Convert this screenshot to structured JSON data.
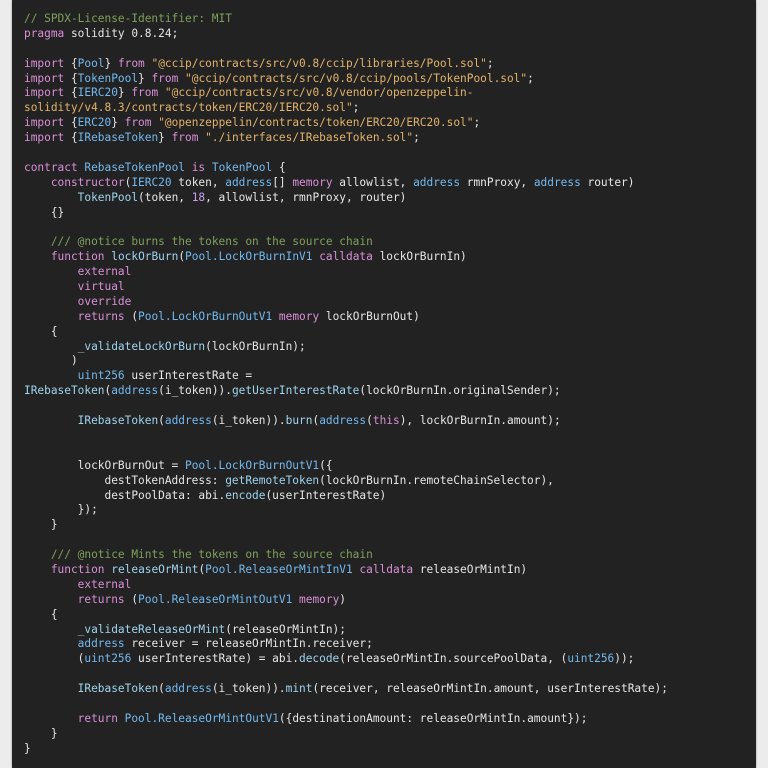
{
  "editor": {
    "theme_colors": {
      "background": "#222222",
      "comment": "#7ea05c",
      "keyword": "#d98fd6",
      "type": "#73b9ef",
      "string": "#e3b36a",
      "number": "#c6a0f2",
      "plain": "#e6e6e6"
    },
    "lines": [
      [
        [
          "c",
          "// SPDX-License-Identifier: MIT"
        ]
      ],
      [
        [
          "k",
          "pragma"
        ],
        [
          "p",
          " solidity "
        ],
        [
          "p",
          "0.8.24;"
        ]
      ],
      [],
      [
        [
          "k",
          "import"
        ],
        [
          "p",
          " {"
        ],
        [
          "t",
          "Pool"
        ],
        [
          "p",
          "} "
        ],
        [
          "k",
          "from"
        ],
        [
          "p",
          " "
        ],
        [
          "s",
          "\"@ccip/contracts/src/v0.8/ccip/libraries/Pool.sol\""
        ],
        [
          "p",
          ";"
        ]
      ],
      [
        [
          "k",
          "import"
        ],
        [
          "p",
          " {"
        ],
        [
          "t",
          "TokenPool"
        ],
        [
          "p",
          "} "
        ],
        [
          "k",
          "from"
        ],
        [
          "p",
          " "
        ],
        [
          "s",
          "\"@ccip/contracts/src/v0.8/ccip/pools/TokenPool.sol\""
        ],
        [
          "p",
          ";"
        ]
      ],
      [
        [
          "k",
          "import"
        ],
        [
          "p",
          " {"
        ],
        [
          "t",
          "IERC20"
        ],
        [
          "p",
          "} "
        ],
        [
          "k",
          "from"
        ],
        [
          "p",
          " "
        ],
        [
          "s",
          "\"@ccip/contracts/src/v0.8/vendor/openzeppelin-"
        ]
      ],
      [
        [
          "s",
          "solidity/v4.8.3/contracts/token/ERC20/IERC20.sol\""
        ],
        [
          "p",
          ";"
        ]
      ],
      [
        [
          "k",
          "import"
        ],
        [
          "p",
          " {"
        ],
        [
          "t",
          "ERC20"
        ],
        [
          "p",
          "} "
        ],
        [
          "k",
          "from"
        ],
        [
          "p",
          " "
        ],
        [
          "s",
          "\"@openzeppelin/contracts/token/ERC20/ERC20.sol\""
        ],
        [
          "p",
          ";"
        ]
      ],
      [
        [
          "k",
          "import"
        ],
        [
          "p",
          " {"
        ],
        [
          "t",
          "IRebaseToken"
        ],
        [
          "p",
          "} "
        ],
        [
          "k",
          "from"
        ],
        [
          "p",
          " "
        ],
        [
          "s",
          "\"./interfaces/IRebaseToken.sol\""
        ],
        [
          "p",
          ";"
        ]
      ],
      [],
      [
        [
          "k",
          "contract"
        ],
        [
          "p",
          " "
        ],
        [
          "t",
          "RebaseTokenPool"
        ],
        [
          "p",
          " "
        ],
        [
          "k",
          "is"
        ],
        [
          "p",
          " "
        ],
        [
          "t",
          "TokenPool"
        ],
        [
          "p",
          " {"
        ]
      ],
      [
        [
          "p",
          "    "
        ],
        [
          "k",
          "constructor"
        ],
        [
          "p",
          "("
        ],
        [
          "t",
          "IERC20"
        ],
        [
          "p",
          " token, "
        ],
        [
          "t",
          "address"
        ],
        [
          "p",
          "[] "
        ],
        [
          "k",
          "memory"
        ],
        [
          "p",
          " allowlist, "
        ],
        [
          "t",
          "address"
        ],
        [
          "p",
          " rmnProxy, "
        ],
        [
          "t",
          "address"
        ],
        [
          "p",
          " router)"
        ]
      ],
      [
        [
          "p",
          "        "
        ],
        [
          "f",
          "TokenPool"
        ],
        [
          "p",
          "(token, "
        ],
        [
          "n",
          "18"
        ],
        [
          "p",
          ", allowlist, rmnProxy, router)"
        ]
      ],
      [
        [
          "p",
          "    {}"
        ]
      ],
      [],
      [
        [
          "p",
          "    "
        ],
        [
          "c",
          "/// @notice burns the tokens on the source chain"
        ]
      ],
      [
        [
          "p",
          "    "
        ],
        [
          "k",
          "function"
        ],
        [
          "p",
          " "
        ],
        [
          "f",
          "lockOrBurn"
        ],
        [
          "p",
          "("
        ],
        [
          "t",
          "Pool.LockOrBurnInV1"
        ],
        [
          "p",
          " "
        ],
        [
          "k",
          "calldata"
        ],
        [
          "p",
          " lockOrBurnIn)"
        ]
      ],
      [
        [
          "p",
          "        "
        ],
        [
          "k",
          "external"
        ]
      ],
      [
        [
          "p",
          "        "
        ],
        [
          "k",
          "virtual"
        ]
      ],
      [
        [
          "p",
          "        "
        ],
        [
          "k",
          "override"
        ]
      ],
      [
        [
          "p",
          "        "
        ],
        [
          "k",
          "returns"
        ],
        [
          "p",
          " ("
        ],
        [
          "t",
          "Pool.LockOrBurnOutV1"
        ],
        [
          "p",
          " "
        ],
        [
          "k",
          "memory"
        ],
        [
          "p",
          " lockOrBurnOut)"
        ]
      ],
      [
        [
          "p",
          "    {"
        ]
      ],
      [
        [
          "p",
          "        "
        ],
        [
          "f",
          "_validateLockOrBurn"
        ],
        [
          "p",
          "(lockOrBurnIn);"
        ]
      ],
      [
        [
          "p",
          "       )"
        ]
      ],
      [
        [
          "p",
          "        "
        ],
        [
          "t",
          "uint256"
        ],
        [
          "p",
          " userInterestRate ="
        ]
      ],
      [
        [
          "f",
          "IRebaseToken"
        ],
        [
          "p",
          "("
        ],
        [
          "t",
          "address"
        ],
        [
          "p",
          "(i_token))."
        ],
        [
          "f",
          "getUserInterestRate"
        ],
        [
          "p",
          "(lockOrBurnIn.originalSender);"
        ]
      ],
      [],
      [
        [
          "p",
          "        "
        ],
        [
          "f",
          "IRebaseToken"
        ],
        [
          "p",
          "("
        ],
        [
          "t",
          "address"
        ],
        [
          "p",
          "(i_token))."
        ],
        [
          "f",
          "burn"
        ],
        [
          "p",
          "("
        ],
        [
          "t",
          "address"
        ],
        [
          "p",
          "("
        ],
        [
          "k",
          "this"
        ],
        [
          "p",
          "), lockOrBurnIn.amount);"
        ]
      ],
      [],
      [],
      [
        [
          "p",
          "        lockOrBurnOut = "
        ],
        [
          "t",
          "Pool.LockOrBurnOutV1"
        ],
        [
          "p",
          "({"
        ]
      ],
      [
        [
          "p",
          "            destTokenAddress: "
        ],
        [
          "f",
          "getRemoteToken"
        ],
        [
          "p",
          "(lockOrBurnIn.remoteChainSelector),"
        ]
      ],
      [
        [
          "p",
          "            destPoolData: abi."
        ],
        [
          "f",
          "encode"
        ],
        [
          "p",
          "(userInterestRate)"
        ]
      ],
      [
        [
          "p",
          "        });"
        ]
      ],
      [
        [
          "p",
          "    }"
        ]
      ],
      [],
      [
        [
          "p",
          "    "
        ],
        [
          "c",
          "/// @notice Mints the tokens on the source chain"
        ]
      ],
      [
        [
          "p",
          "    "
        ],
        [
          "k",
          "function"
        ],
        [
          "p",
          " "
        ],
        [
          "f",
          "releaseOrMint"
        ],
        [
          "p",
          "("
        ],
        [
          "t",
          "Pool.ReleaseOrMintInV1"
        ],
        [
          "p",
          " "
        ],
        [
          "k",
          "calldata"
        ],
        [
          "p",
          " releaseOrMintIn)"
        ]
      ],
      [
        [
          "p",
          "        "
        ],
        [
          "k",
          "external"
        ]
      ],
      [
        [
          "p",
          "        "
        ],
        [
          "k",
          "returns"
        ],
        [
          "p",
          " ("
        ],
        [
          "t",
          "Pool.ReleaseOrMintOutV1"
        ],
        [
          "p",
          " "
        ],
        [
          "k",
          "memory"
        ],
        [
          "p",
          ")"
        ]
      ],
      [
        [
          "p",
          "    {"
        ]
      ],
      [
        [
          "p",
          "        "
        ],
        [
          "f",
          "_validateReleaseOrMint"
        ],
        [
          "p",
          "(releaseOrMintIn);"
        ]
      ],
      [
        [
          "p",
          "        "
        ],
        [
          "t",
          "address"
        ],
        [
          "p",
          " receiver = releaseOrMintIn.receiver;"
        ]
      ],
      [
        [
          "p",
          "        ("
        ],
        [
          "t",
          "uint256"
        ],
        [
          "p",
          " userInterestRate) = abi."
        ],
        [
          "f",
          "decode"
        ],
        [
          "p",
          "(releaseOrMintIn.sourcePoolData, ("
        ],
        [
          "t",
          "uint256"
        ],
        [
          "p",
          "));"
        ]
      ],
      [],
      [
        [
          "p",
          "        "
        ],
        [
          "f",
          "IRebaseToken"
        ],
        [
          "p",
          "("
        ],
        [
          "t",
          "address"
        ],
        [
          "p",
          "(i_token))."
        ],
        [
          "f",
          "mint"
        ],
        [
          "p",
          "(receiver, releaseOrMintIn.amount, userInterestRate);"
        ]
      ],
      [],
      [
        [
          "p",
          "        "
        ],
        [
          "k",
          "return"
        ],
        [
          "p",
          " "
        ],
        [
          "t",
          "Pool.ReleaseOrMintOutV1"
        ],
        [
          "p",
          "({destinationAmount: releaseOrMintIn.amount});"
        ]
      ],
      [
        [
          "p",
          "    }"
        ]
      ],
      [
        [
          "p",
          "}"
        ]
      ]
    ]
  }
}
